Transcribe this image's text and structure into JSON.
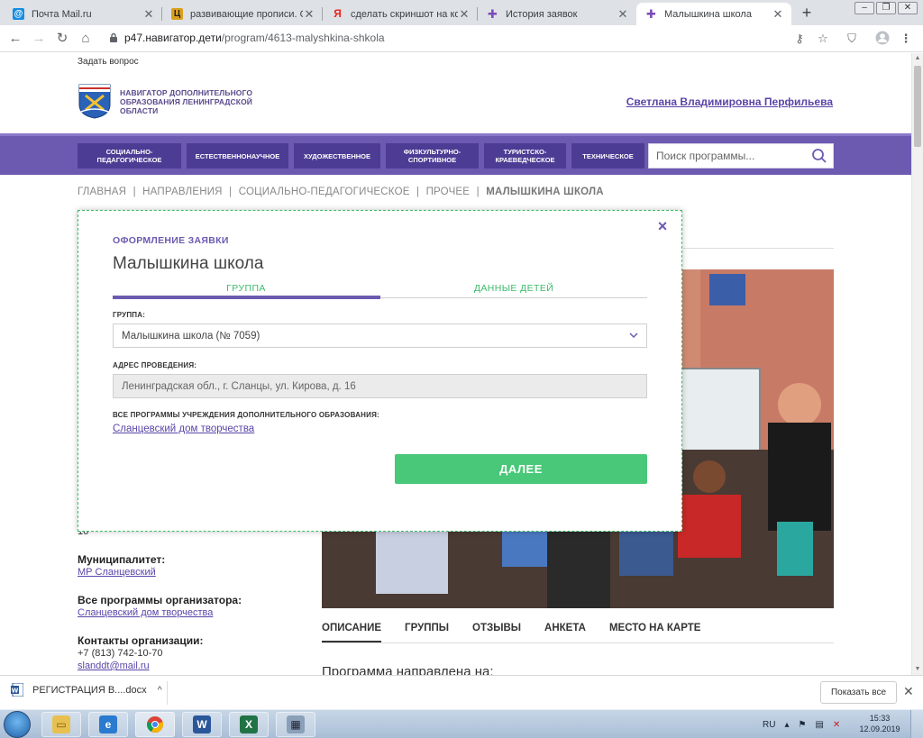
{
  "browser": {
    "tabs": [
      {
        "title": "Почта Mail.ru",
        "favicon_color": "#168de2",
        "favicon_glyph": "@"
      },
      {
        "title": "развивающие прописи. Обо",
        "favicon_color": "#d9a01e",
        "favicon_glyph": "Ц"
      },
      {
        "title": "сделать скриншот на компь",
        "favicon_color": "#ffffff",
        "favicon_glyph": "Я"
      },
      {
        "title": "История заявок",
        "favicon_color": "#ffffff",
        "favicon_glyph": "✚"
      },
      {
        "title": "Малышкина школа",
        "favicon_color": "#ffffff",
        "favicon_glyph": "✚"
      }
    ],
    "new_tab": "+",
    "url_host": "p47.навигатор.дети",
    "url_path": "/program/4613-malyshkina-shkola"
  },
  "site": {
    "ask_link": "Задать вопрос",
    "logo_text": "НАВИГАТОР ДОПОЛНИТЕЛЬНОГО ОБРАЗОВАНИЯ ЛЕНИНГРАДСКОЙ ОБЛАСТИ",
    "user_name": "Светлана Владимировна Перфильева",
    "categories": [
      "СОЦИАЛЬНО-ПЕДАГОГИЧЕСКОЕ",
      "ЕСТЕСТВЕННОНАУЧНОЕ",
      "ХУДОЖЕСТВЕННОЕ",
      "ФИЗКУЛЬТУРНО-СПОРТИВНОЕ",
      "ТУРИСТСКО-КРАЕВЕДЧЕСКОЕ",
      "ТЕХНИЧЕСКОЕ"
    ],
    "search_placeholder": "Поиск программы...",
    "breadcrumbs": [
      "ГЛАВНАЯ",
      "НАПРАВЛЕНИЯ",
      "СОЦИАЛЬНО-ПЕДАГОГИЧЕСКОЕ",
      "ПРОЧЕЕ"
    ],
    "breadcrumb_current": "МАЛЫШКИНА ШКОЛА",
    "breadcrumb_sep": "|"
  },
  "sidebar": {
    "partial_line": "16",
    "municipality_label": "Муниципалитет:",
    "municipality_value": "МР Сланцевский",
    "organizer_label": "Все программы организатора:",
    "organizer_value": "Сланцевский дом творчества",
    "contacts_label": "Контакты организации:",
    "phone": "+7 (813) 742-10-70",
    "email": "slanddt@mail.ru"
  },
  "program_tabs": [
    "ОПИСАНИЕ",
    "ГРУППЫ",
    "ОТЗЫВЫ",
    "АНКЕТА",
    "МЕСТО НА КАРТЕ"
  ],
  "description_start": "Программа направлена на:",
  "modal": {
    "kicker": "ОФОРМЛЕНИЕ ЗАЯВКИ",
    "title": "Малышкина школа",
    "step_group": "ГРУППА",
    "step_children": "ДАННЫЕ ДЕТЕЙ",
    "group_label": "ГРУППА:",
    "group_value": "Малышкина школа (№ 7059)",
    "address_label": "АДРЕС ПРОВЕДЕНИЯ:",
    "address_value": "Ленинградская обл., г. Сланцы, ул. Кирова, д. 16",
    "all_programs_label": "ВСЕ ПРОГРАММЫ УЧРЕЖДЕНИЯ ДОПОЛНИТЕЛЬНОГО ОБРАЗОВАНИЯ:",
    "all_programs_link": "Сланцевский дом творчества",
    "next_button": "ДАЛЕЕ",
    "close": "×"
  },
  "downloads": {
    "file": "РЕГИСТРАЦИЯ В....docx",
    "show_all": "Показать все",
    "close": "✕"
  },
  "taskbar": {
    "lang": "RU",
    "time": "15:33",
    "date": "12.09.2019"
  },
  "colors": {
    "brand_purple": "#6c5ab0",
    "category_bg": "#4c3c94",
    "accent_green": "#48c878",
    "link": "#5a45a8"
  }
}
